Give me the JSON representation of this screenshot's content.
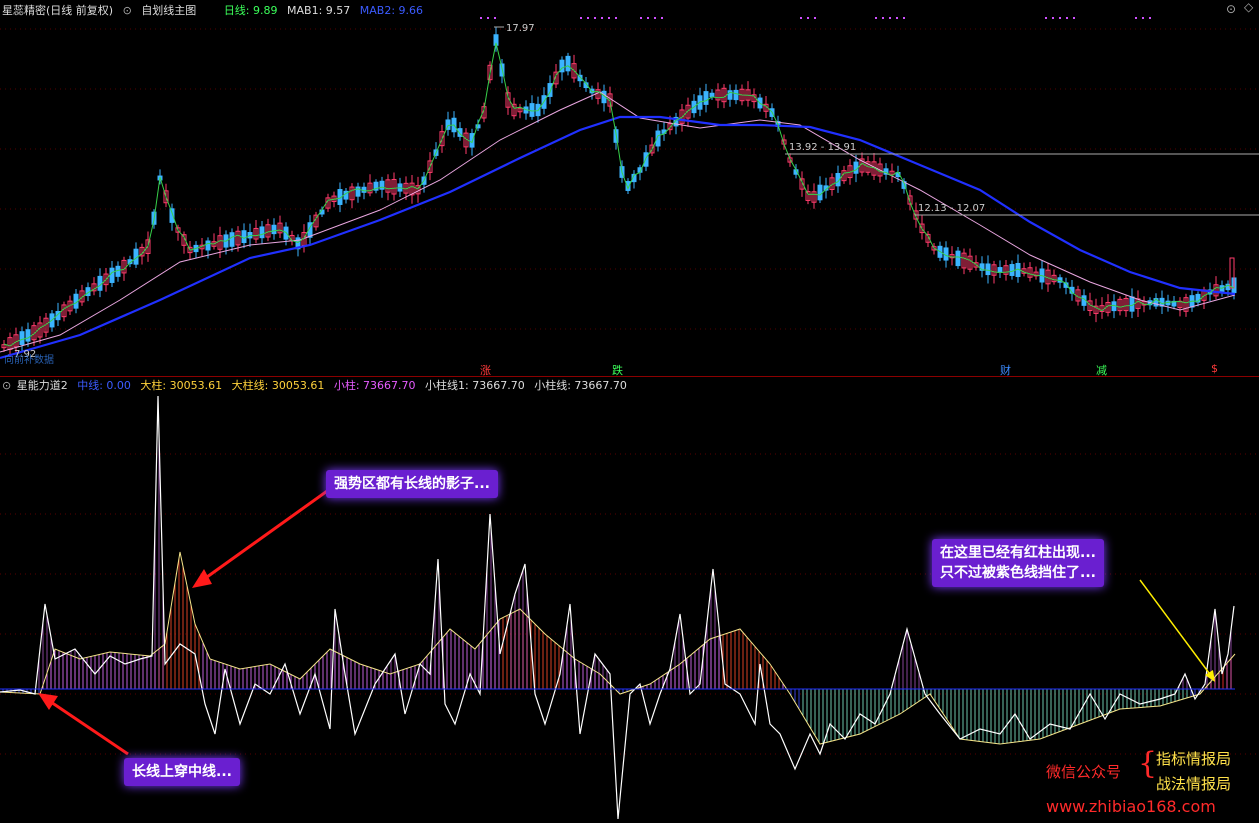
{
  "main_header": {
    "stock_name": "星蕊精密(日线 前复权)",
    "template_label": "自划线主图",
    "day_line": "日线: 9.89",
    "mab1": "MAB1: 9.57",
    "mab2": "MAB2: 9.66"
  },
  "main_chart": {
    "peak_label": "17.97",
    "low_label": "7.92",
    "gap_label_1": "13.92 - 13.91",
    "gap_label_2": "12.13 - 12.07",
    "left_note": "向前补数据",
    "signals": [
      {
        "text": "涨",
        "color": "#ff3b3b"
      },
      {
        "text": "跌",
        "color": "#3bff5a"
      },
      {
        "text": "财",
        "color": "#3b8bff"
      },
      {
        "text": "减",
        "color": "#3bff5a"
      },
      {
        "text": "$",
        "color": "#ff3b3b"
      }
    ]
  },
  "sub_header": {
    "indicator": "星能力道2",
    "mid_line": "中线: 0.00",
    "big_bar": "大柱: 30053.61",
    "big_bar_line": "大柱线: 30053.61",
    "small_bar": "小柱: 73667.70",
    "small_bar_line1": "小柱线1: 73667.70",
    "small_bar_line": "小柱线: 73667.70"
  },
  "annotations": {
    "strong_zone": "强势区都有长线的影子...",
    "cross_mid": "长线上穿中线...",
    "red_bar_line1": "在这里已经有红柱出现...",
    "red_bar_line2": "只不过被紫色线挡住了..."
  },
  "watermark": {
    "wechat": "微信公众号",
    "brace": "{",
    "name1": "指标情报局",
    "name2": "战法情报局",
    "url": "www.zhibiao168.com"
  },
  "colors": {
    "up": "#ff3b6b",
    "down": "#3bb4ff",
    "ma_blue": "#2030ff",
    "ma_pink": "#e9a6e0",
    "grid": "#7a0000",
    "callout": "#6a1fd0"
  }
}
